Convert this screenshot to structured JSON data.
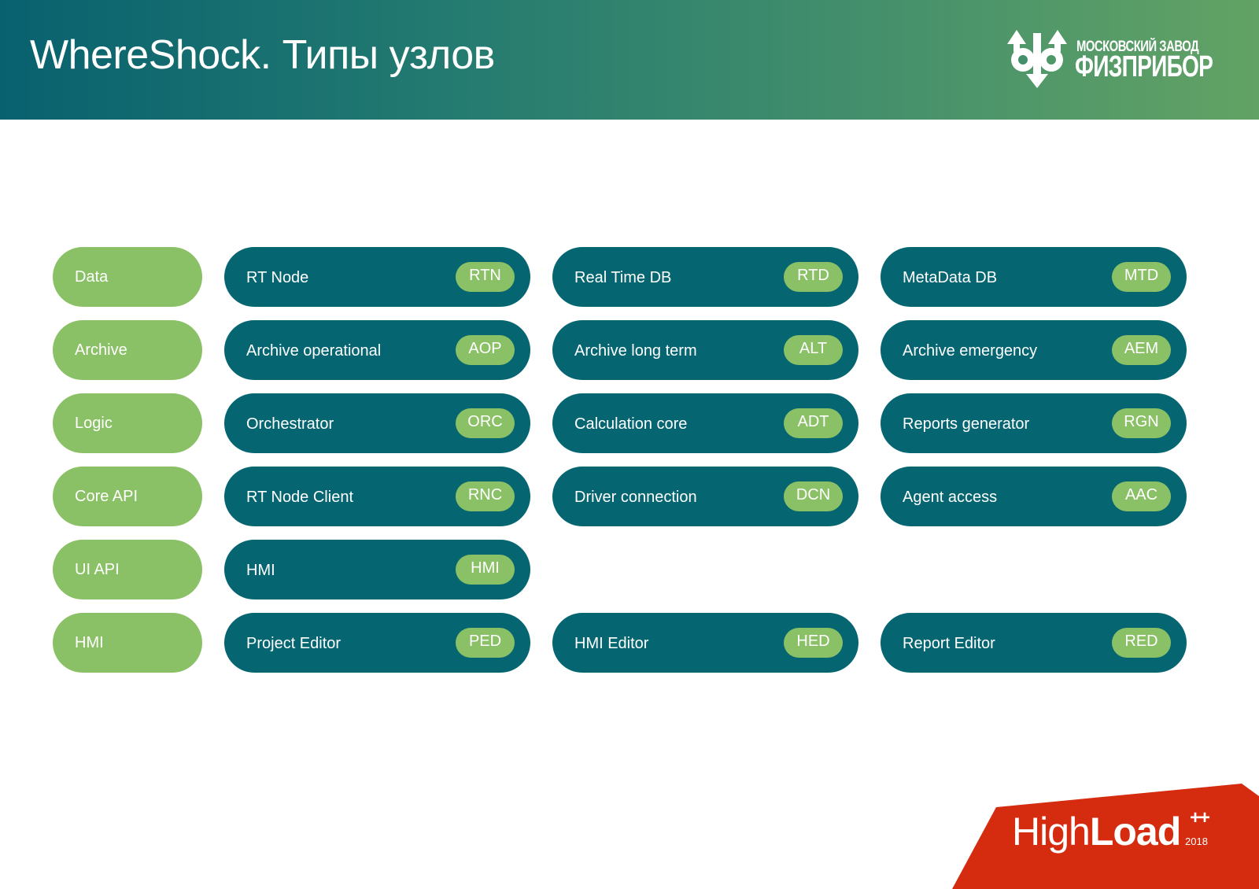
{
  "header": {
    "title": "WhereShock. Типы узлов",
    "logo": {
      "icon": "fizpribor-emblem-icon",
      "line1": "МОСКОВСКИЙ ЗАВОД",
      "line2": "ФИЗПРИБОР"
    }
  },
  "colors": {
    "header_gradient_start": "#08616f",
    "header_gradient_end": "#62a264",
    "category_pill": "#8bc166",
    "node_pill": "#056672",
    "code_badge": "#8bc166",
    "highload_red": "#d52b0f"
  },
  "rows": [
    {
      "category": "Data",
      "nodes": [
        {
          "label": "RT Node",
          "code": "RTN"
        },
        {
          "label": "Real Time DB",
          "code": "RTD"
        },
        {
          "label": "MetaData DB",
          "code": "MTD"
        }
      ]
    },
    {
      "category": "Archive",
      "nodes": [
        {
          "label": "Archive operational",
          "code": "AOP"
        },
        {
          "label": "Archive long term",
          "code": "ALT"
        },
        {
          "label": "Archive emergency",
          "code": "AEM"
        }
      ]
    },
    {
      "category": "Logic",
      "nodes": [
        {
          "label": "Orchestrator",
          "code": "ORC"
        },
        {
          "label": "Calculation core",
          "code": "ADT"
        },
        {
          "label": "Reports generator",
          "code": "RGN"
        }
      ]
    },
    {
      "category": "Core API",
      "nodes": [
        {
          "label": "RT Node Client",
          "code": "RNC"
        },
        {
          "label": "Driver connection",
          "code": "DCN"
        },
        {
          "label": "Agent access",
          "code": "AAC"
        }
      ]
    },
    {
      "category": "UI API",
      "nodes": [
        {
          "label": "HMI",
          "code": "HMI"
        }
      ]
    },
    {
      "category": "HMI",
      "nodes": [
        {
          "label": "Project Editor",
          "code": "PED"
        },
        {
          "label": "HMI Editor",
          "code": "HED"
        },
        {
          "label": "Report Editor",
          "code": "RED"
        }
      ]
    }
  ],
  "footer": {
    "brand_light": "High",
    "brand_bold": "Load",
    "brand_plus": "++",
    "brand_year": "2018"
  }
}
